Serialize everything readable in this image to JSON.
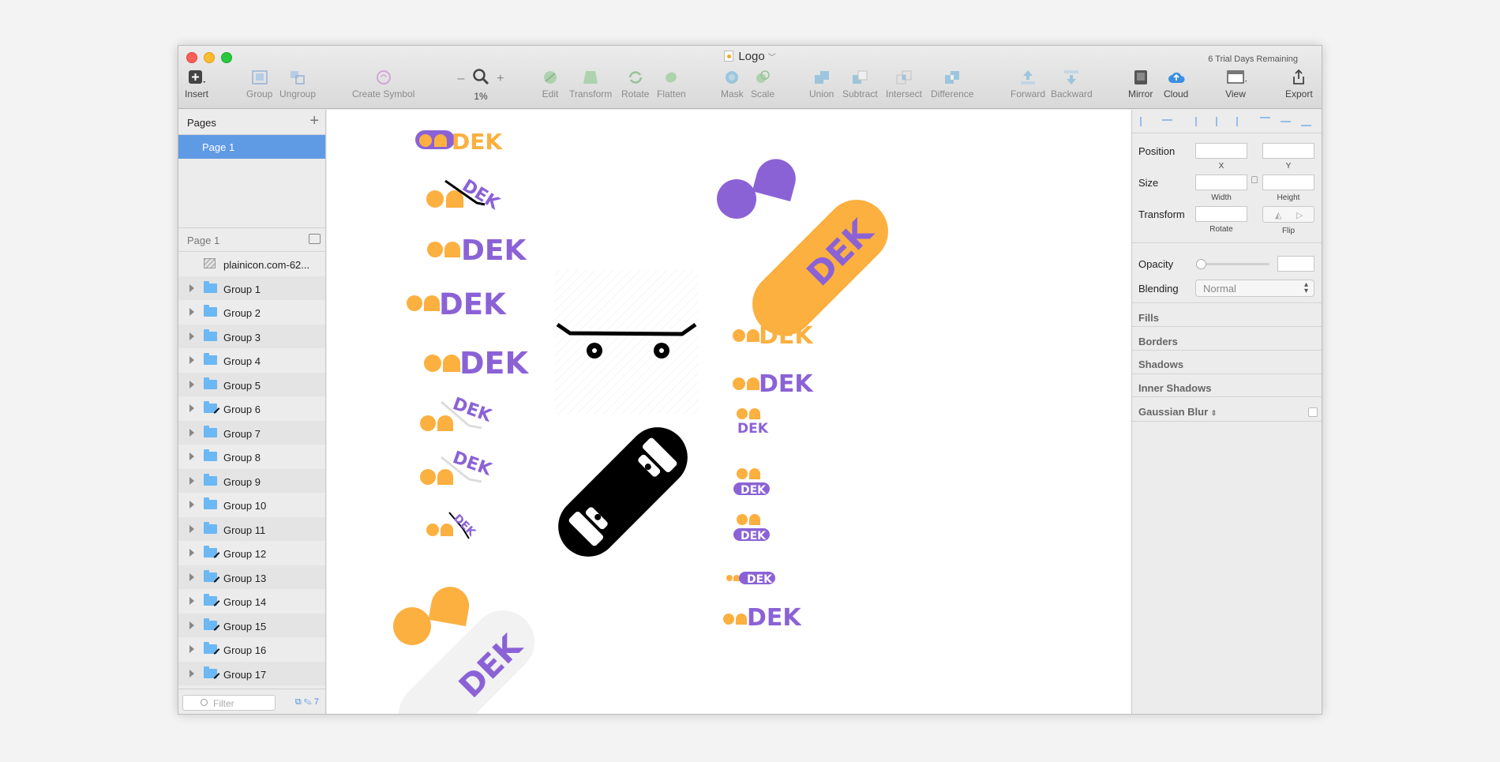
{
  "window": {
    "title": "Logo",
    "trial_notice": "6 Trial Days Remaining"
  },
  "toolbar": {
    "insert": "Insert",
    "group": "Group",
    "ungroup": "Ungroup",
    "create_symbol": "Create Symbol",
    "zoom_minus": "–",
    "zoom_plus": "+",
    "zoom_value": "1%",
    "edit": "Edit",
    "transform": "Transform",
    "rotate": "Rotate",
    "flatten": "Flatten",
    "mask": "Mask",
    "scale": "Scale",
    "union": "Union",
    "subtract": "Subtract",
    "intersect": "Intersect",
    "difference": "Difference",
    "forward": "Forward",
    "backward": "Backward",
    "mirror": "Mirror",
    "cloud": "Cloud",
    "view": "View",
    "export": "Export"
  },
  "sidebar": {
    "pages_header": "Pages",
    "add_symbol": "+",
    "pages": [
      "Page 1"
    ],
    "layers_header": "Page 1",
    "layers": [
      {
        "label": "plainicon.com-62...",
        "type": "image"
      },
      {
        "label": "Group 1",
        "type": "folder"
      },
      {
        "label": "Group 2",
        "type": "folder"
      },
      {
        "label": "Group 3",
        "type": "folder"
      },
      {
        "label": "Group 4",
        "type": "folder"
      },
      {
        "label": "Group 5",
        "type": "folder"
      },
      {
        "label": "Group 6",
        "type": "folder-brush"
      },
      {
        "label": "Group 7",
        "type": "folder"
      },
      {
        "label": "Group 8",
        "type": "folder"
      },
      {
        "label": "Group 9",
        "type": "folder"
      },
      {
        "label": "Group 10",
        "type": "folder"
      },
      {
        "label": "Group 11",
        "type": "folder"
      },
      {
        "label": "Group 12",
        "type": "folder-brush"
      },
      {
        "label": "Group 13",
        "type": "folder-brush"
      },
      {
        "label": "Group 14",
        "type": "folder-brush"
      },
      {
        "label": "Group 15",
        "type": "folder-brush"
      },
      {
        "label": "Group 16",
        "type": "folder-brush"
      },
      {
        "label": "Group 17",
        "type": "folder-brush"
      }
    ],
    "filter_placeholder": "Filter",
    "footer_count": "7"
  },
  "canvas": {
    "logo_word": "DEK",
    "colors": {
      "orange": "#fbb040",
      "purple": "#8b62d6",
      "black": "#000000",
      "lightgray": "#f2f2f2"
    }
  },
  "inspector": {
    "position": "Position",
    "x": "X",
    "y": "Y",
    "size": "Size",
    "width": "Width",
    "height": "Height",
    "transform": "Transform",
    "rotate": "Rotate",
    "flip": "Flip",
    "opacity": "Opacity",
    "blending": "Blending",
    "blending_value": "Normal",
    "fills": "Fills",
    "borders": "Borders",
    "shadows": "Shadows",
    "inner_shadows": "Inner Shadows",
    "gaussian_blur": "Gaussian Blur"
  }
}
